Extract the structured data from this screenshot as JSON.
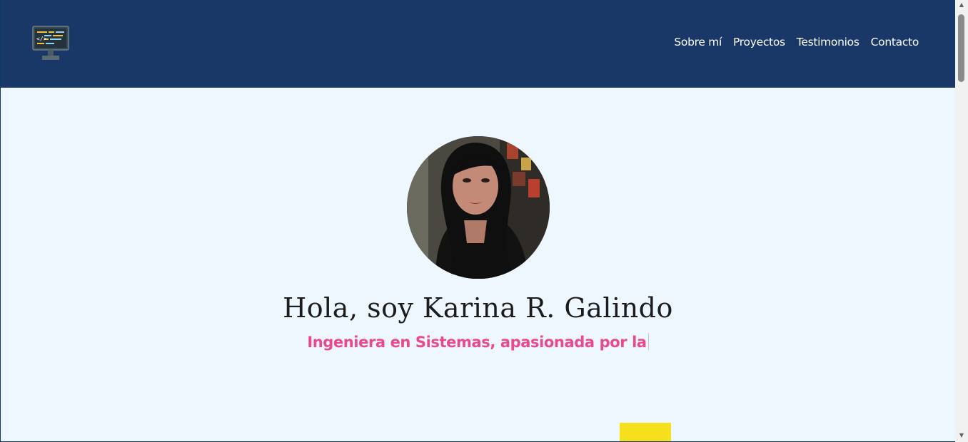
{
  "header": {
    "logo_icon": "code-monitor-icon",
    "nav": [
      {
        "label": "Sobre mí"
      },
      {
        "label": "Proyectos"
      },
      {
        "label": "Testimonios"
      },
      {
        "label": "Contacto"
      }
    ]
  },
  "hero": {
    "avatar": "profile-photo",
    "title": "Hola, soy Karina R. Galindo",
    "subtitle": "Ingeniera en Sistemas, apasionada por la"
  },
  "colors": {
    "header_bg": "#1a3867",
    "page_bg": "#eff7fe",
    "accent_pink": "#e8498f",
    "accent_yellow": "#f6e01d"
  }
}
